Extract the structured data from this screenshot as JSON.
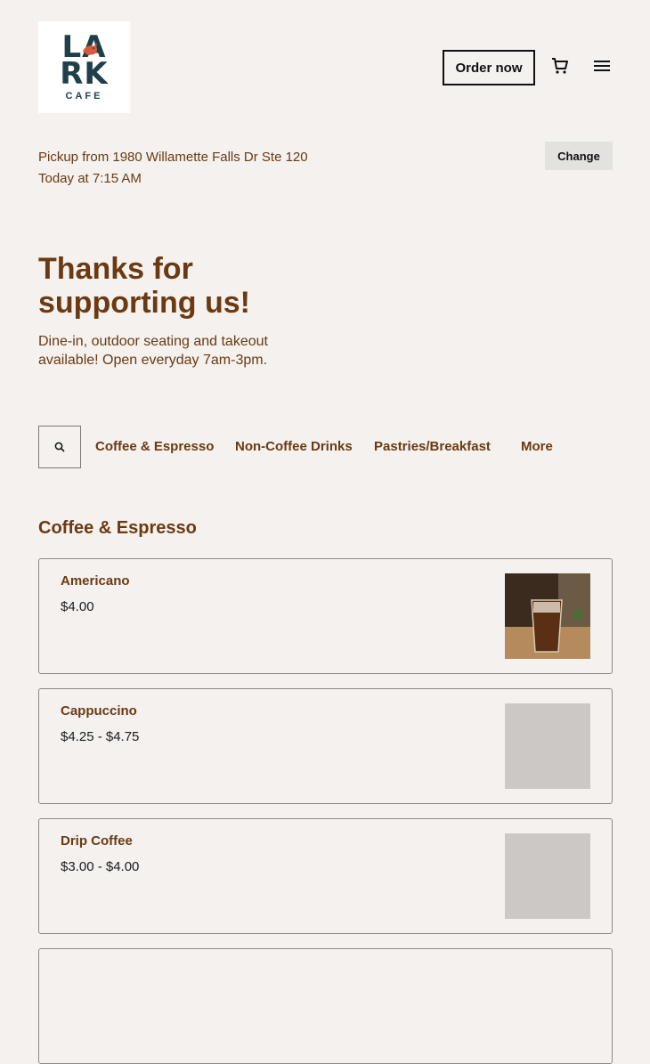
{
  "brand": {
    "wordmark_line1": "LA",
    "wordmark_line2": "RK",
    "wordmark_sub": "CAFE"
  },
  "header": {
    "order_label": "Order now"
  },
  "pickup": {
    "line1": "Pickup from 1980 Willamette Falls Dr Ste 120",
    "line2": "Today at 7:15 AM",
    "change_label": "Change"
  },
  "hero": {
    "title_line1": "Thanks for",
    "title_line2": "supporting us!",
    "subtitle_line1": "Dine-in, outdoor seating and takeout",
    "subtitle_line2": "available! Open everyday 7am-3pm."
  },
  "tabs": [
    {
      "label": "Coffee & Espresso"
    },
    {
      "label": "Non-Coffee Drinks"
    },
    {
      "label": "Pastries/Breakfast"
    },
    {
      "label": "More"
    }
  ],
  "section": {
    "title": "Coffee & Espresso"
  },
  "items": [
    {
      "name": "Americano",
      "price": "$4.00"
    },
    {
      "name": "Cappuccino",
      "price": "$4.25 - $4.75"
    },
    {
      "name": "Drip Coffee",
      "price": "$3.00 - $4.00"
    }
  ],
  "colors": {
    "accent": "#6b3a12",
    "background": "#f4f1ee",
    "logo_text": "#1f3f4a"
  }
}
